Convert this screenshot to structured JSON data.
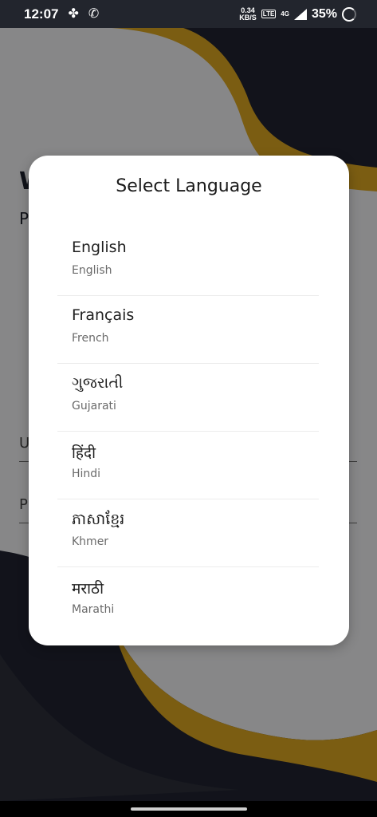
{
  "status_bar": {
    "time": "12:07",
    "net_speed_value": "0.34",
    "net_speed_unit": "KB/S",
    "volte_badge": "LTE",
    "network": "4G",
    "battery": "35%"
  },
  "background_page": {
    "title": "W",
    "subtitle": "P",
    "field_1": "U",
    "field_2": "P"
  },
  "dialog": {
    "title": "Select Language",
    "languages": [
      {
        "native": "English",
        "english": "English"
      },
      {
        "native": "Français",
        "english": "French"
      },
      {
        "native": "ગુજરાતી",
        "english": "Gujarati"
      },
      {
        "native": "हिंदी",
        "english": "Hindi"
      },
      {
        "native": "ភាសាខ្មែរ",
        "english": "Khmer"
      },
      {
        "native": "मराठी",
        "english": "Marathi"
      }
    ]
  },
  "colors": {
    "accent_yellow": "#d4a020",
    "dark_navy": "#1f2230",
    "light_gray": "#e9e9ea"
  }
}
